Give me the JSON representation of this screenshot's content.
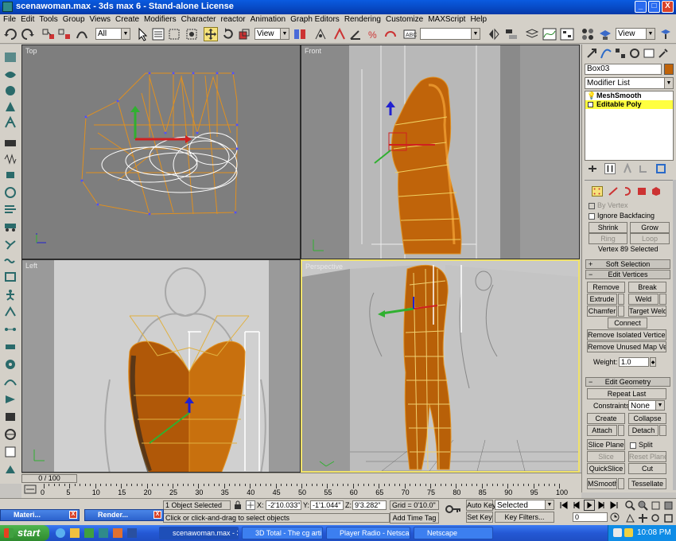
{
  "window": {
    "title": "scenawoman.max - 3ds max 6 - Stand-alone License",
    "min_label": "_",
    "max_label": "□",
    "close_label": "X"
  },
  "menu": [
    "File",
    "Edit",
    "Tools",
    "Group",
    "Views",
    "Create",
    "Modifiers",
    "Character",
    "reactor",
    "Animation",
    "Graph Editors",
    "Rendering",
    "Customize",
    "MAXScript",
    "Help"
  ],
  "toolbar": {
    "selection_filter": "All",
    "ref_coord": "View",
    "named_selection": "",
    "render_view": "View"
  },
  "viewports": {
    "top_label": "Top",
    "front_label": "Front",
    "left_label": "Left",
    "perspective_label": "Perspective"
  },
  "command_panel": {
    "object_name": "Box03",
    "modifier_list": "Modifier List",
    "stack": [
      "MeshSmooth",
      "Editable Poly"
    ],
    "by_vertex": "By Vertex",
    "ignore_backfacing": "Ignore Backfacing",
    "shrink": "Shrink",
    "grow": "Grow",
    "ring": "Ring",
    "loop": "Loop",
    "selection_status": "Vertex 89 Selected",
    "soft_selection": "Soft Selection",
    "edit_vertices": "Edit Vertices",
    "remove": "Remove",
    "break": "Break",
    "extrude": "Extrude",
    "weld": "Weld",
    "chamfer": "Chamfer",
    "target_weld": "Target Weld",
    "connect": "Connect",
    "remove_isolated": "Remove Isolated Vertices",
    "remove_unused": "Remove Unused Map Verts",
    "weight_label": "Weight:",
    "weight_value": "1.0",
    "edit_geometry": "Edit Geometry",
    "repeat_last": "Repeat Last",
    "constraints_label": "Constraints:",
    "constraints_value": "None",
    "create": "Create",
    "collapse": "Collapse",
    "attach": "Attach",
    "detach": "Detach",
    "slice_plane": "Slice Plane",
    "split": "Split",
    "slice": "Slice",
    "reset_plane": "Reset Plane",
    "quickslice": "QuickSlice",
    "cut": "Cut",
    "msmooth": "MSmooth",
    "tessellate": "Tessellate"
  },
  "timeline": {
    "frame_display": "0 / 100",
    "ticks": [
      "0",
      "5",
      "10",
      "15",
      "20",
      "25",
      "30",
      "35",
      "40",
      "45",
      "50",
      "55",
      "60",
      "65",
      "70",
      "75",
      "80",
      "85",
      "90",
      "95",
      "100"
    ]
  },
  "status": {
    "selected": "1 Object Selected",
    "prompt": "Click or click-and-drag to select objects",
    "x_label": "X:",
    "x_value": "-2'10.033\"",
    "y_label": "Y:",
    "y_value": "-1'1.044\"",
    "z_label": "Z:",
    "z_value": "9'3.282\"",
    "grid": "Grid = 0'10.0\"",
    "add_time_tag": "Add Time Tag",
    "auto_key": "Auto Key",
    "selected_combo": "Selected",
    "set_key": "Set Key",
    "key_filters": "Key Filters...",
    "frame_field": "0"
  },
  "minimized": [
    "Materi...",
    "Render..."
  ],
  "taskbar": {
    "start": "start",
    "tasks": [
      "scenawoman.max - 3...",
      "3D Total - The cg arti...",
      "Player Radio - Netscape",
      "Netscape"
    ],
    "clock": "10:08 PM"
  }
}
